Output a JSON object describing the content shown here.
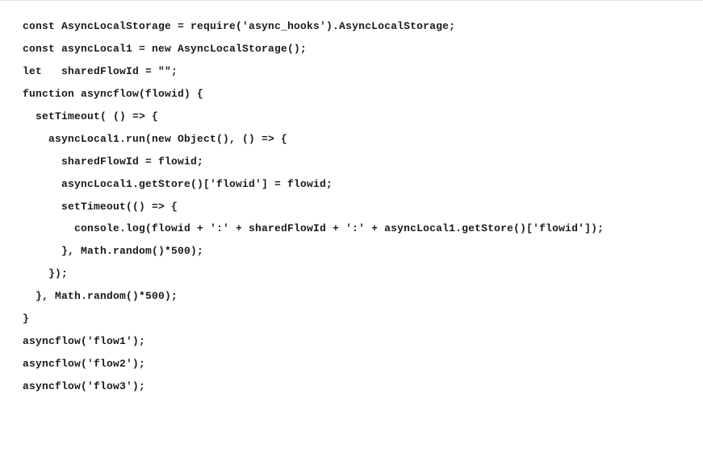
{
  "code": {
    "lines": [
      "const AsyncLocalStorage = require('async_hooks').AsyncLocalStorage;",
      "",
      "const asyncLocal1 = new AsyncLocalStorage();",
      "",
      "let   sharedFlowId = \"\";",
      "",
      "function asyncflow(flowid) {",
      "",
      "  setTimeout( () => {",
      "",
      "    asyncLocal1.run(new Object(), () => {",
      "",
      "      sharedFlowId = flowid;",
      "",
      "      asyncLocal1.getStore()['flowid'] = flowid;",
      "",
      "      setTimeout(() => {",
      "",
      "        console.log(flowid + ':' + sharedFlowId + ':' + asyncLocal1.getStore()['flowid']);",
      "",
      "      }, Math.random()*500);",
      "",
      "    });",
      "",
      "  }, Math.random()*500);",
      "",
      "}",
      "",
      "asyncflow('flow1');",
      "",
      "asyncflow('flow2');",
      "",
      "asyncflow('flow3');"
    ]
  }
}
